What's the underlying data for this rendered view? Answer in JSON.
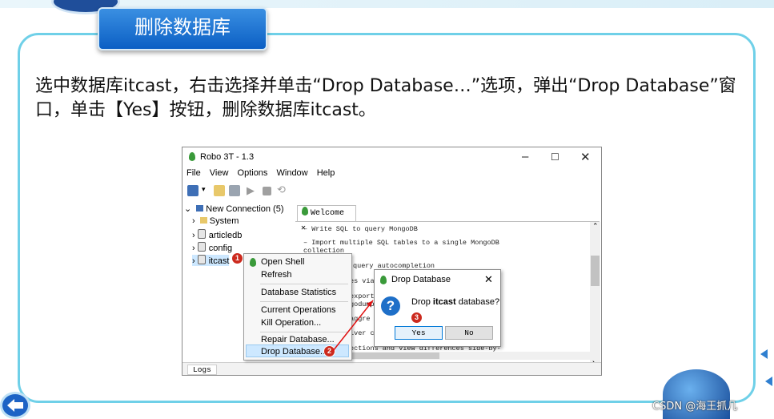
{
  "slide": {
    "banner_title": "删除数据库",
    "description": "选中数据库itcast，右击选择并单击“Drop Database…”选项，弹出“Drop Database”窗口，单击【Yes】按钮，删除数据库itcast。",
    "watermark": "CSDN @海王抓几"
  },
  "window": {
    "title": "Robo 3T - 1.3",
    "menu": [
      "File",
      "View",
      "Options",
      "Window",
      "Help"
    ],
    "tree": {
      "connection": "New Connection (5)",
      "items": [
        "System",
        "articledb",
        "config",
        "itcast"
      ]
    },
    "tab_label": "Welcome",
    "content_lines": [
      "– Write SQL to query MongoDB",
      "– Import multiple SQL tables to a single MongoDB",
      "collection",
      "query autocompletion",
      "es via",
      "export",
      "godump",
      "aggre",
      "iver co",
      "ections and view differences side-by-"
    ],
    "logs_tab": "Logs"
  },
  "context_menu": {
    "items": [
      "Open Shell",
      "Refresh",
      "Database Statistics",
      "Current Operations",
      "Kill Operation...",
      "Repair Database...",
      "Drop Database..."
    ]
  },
  "dialog": {
    "title": "Drop Database",
    "message_prefix": "Drop ",
    "message_db": "itcast",
    "message_suffix": " database?",
    "yes_label": "Yes",
    "no_label": "No"
  },
  "badges": [
    "1",
    "2",
    "3"
  ],
  "colors": {
    "frame_border": "#6fd0e8",
    "banner_blue": "#0b5fc4",
    "badge_red": "#cc2a1e",
    "arrow_red": "#e01010",
    "menu_highlight": "#cde8ff"
  },
  "icons": [
    "robo3t-leaf-icon",
    "question-icon",
    "back-arrow-icon",
    "database-icon",
    "folder-icon"
  ]
}
